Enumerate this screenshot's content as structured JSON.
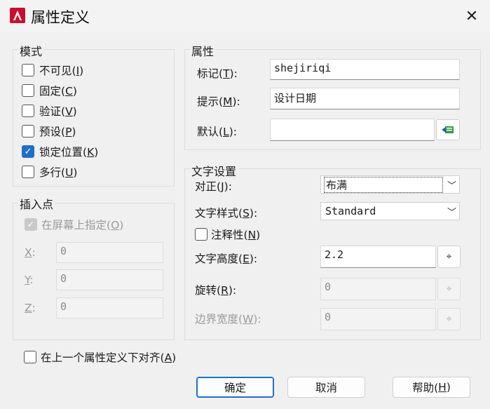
{
  "title": "属性定义",
  "mode": {
    "legend": "模式",
    "items": [
      {
        "label": "不可见(",
        "key": "I",
        "end": ")",
        "checked": false
      },
      {
        "label": "固定(",
        "key": "C",
        "end": ")",
        "checked": false
      },
      {
        "label": "验证(",
        "key": "V",
        "end": ")",
        "checked": false
      },
      {
        "label": "预设(",
        "key": "P",
        "end": ")",
        "checked": false
      },
      {
        "label": "锁定位置(",
        "key": "K",
        "end": ")",
        "checked": true
      },
      {
        "label": "多行(",
        "key": "U",
        "end": ")",
        "checked": false
      }
    ]
  },
  "insert": {
    "legend": "插入点",
    "onscreen_label": "在屏幕上指定(",
    "onscreen_key": "O",
    "onscreen_end": ")",
    "x_label": "X",
    "y_label": "Y",
    "z_label": "Z",
    "colon": ":",
    "x": "0",
    "y": "0",
    "z": "0"
  },
  "attribute": {
    "legend": "属性",
    "tag_label": "标记(",
    "tag_key": "T",
    "tag_end": "):",
    "tag": "shejiriqi",
    "prompt_label": "提示(",
    "prompt_key": "M",
    "prompt_end": "):",
    "prompt": "设计日期",
    "default_label": "默认(",
    "default_key": "L",
    "default_end": "):",
    "default": ""
  },
  "text": {
    "legend": "文字设置",
    "justify_label": "对正(",
    "justify_key": "J",
    "justify_end": "):",
    "justify": "布满",
    "style_label": "文字样式(",
    "style_key": "S",
    "style_end": "):",
    "style": "Standard",
    "annot_label": "注释性(",
    "annot_key": "N",
    "annot_end": ")",
    "height_label": "文字高度(",
    "height_key": "E",
    "height_end": "):",
    "height": "2.2",
    "rotation_label": "旋转(",
    "rotation_key": "R",
    "rotation_end": "):",
    "rotation": "0",
    "border_label": "边界宽度(",
    "border_key": "W",
    "border_end": "):",
    "border": "0"
  },
  "align_below": {
    "label": "在上一个属性定义下对齐(",
    "key": "A",
    "end": ")"
  },
  "buttons": {
    "ok": "确定",
    "cancel": "取消",
    "help_label": "帮助(",
    "help_key": "H",
    "help_end": ")"
  }
}
